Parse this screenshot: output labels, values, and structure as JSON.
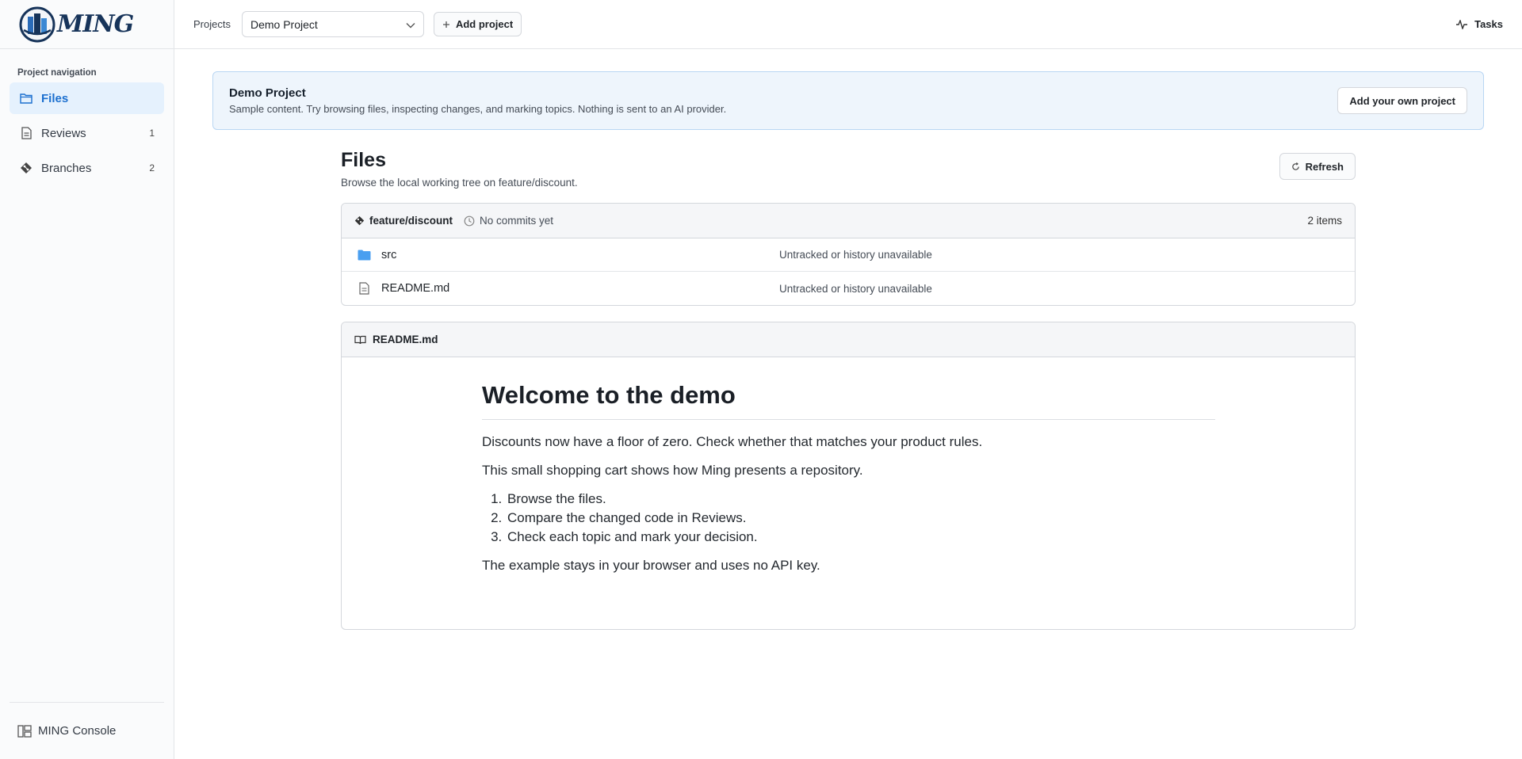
{
  "brand": {
    "name": "MING"
  },
  "sidebar": {
    "caption": "Project navigation",
    "items": [
      {
        "label": "Files",
        "count": "",
        "icon": "folder-icon",
        "active": true
      },
      {
        "label": "Reviews",
        "count": "1",
        "icon": "document-icon",
        "active": false
      },
      {
        "label": "Branches",
        "count": "2",
        "icon": "git-branch-icon",
        "active": false
      }
    ],
    "footer": {
      "label": "MING Console",
      "icon": "console-layout-icon"
    }
  },
  "topbar": {
    "projects_label": "Projects",
    "project_selected": "Demo Project",
    "add_project_label": "Add project",
    "tasks_label": "Tasks"
  },
  "banner": {
    "title": "Demo Project",
    "subtitle": "Sample content. Try browsing files, inspecting changes, and marking topics. Nothing is sent to an AI provider.",
    "button_label": "Add your own project"
  },
  "files": {
    "title": "Files",
    "subtitle": "Browse the local working tree on feature/discount.",
    "refresh_label": "Refresh",
    "branch": "feature/discount",
    "commits": "No commits yet",
    "count": "2 items",
    "rows": [
      {
        "name": "src",
        "status": "Untracked or history unavailable",
        "type": "folder"
      },
      {
        "name": "README.md",
        "status": "Untracked or history unavailable",
        "type": "file"
      }
    ]
  },
  "readme": {
    "header": "README.md",
    "heading": "Welcome to the demo",
    "paragraph1": "Discounts now have a floor of zero. Check whether that matches your product rules.",
    "paragraph2": "This small shopping cart shows how Ming presents a repository.",
    "steps": [
      "Browse the files.",
      "Compare the changed code in Reviews.",
      "Check each topic and mark your decision."
    ],
    "paragraph3": "The example stays in your browser and uses no API key."
  },
  "colors": {
    "accent": "#1b6fcf",
    "active_bg": "#e5f1fd",
    "banner_bg": "#eef5fc",
    "folder": "#4a9ff0"
  }
}
